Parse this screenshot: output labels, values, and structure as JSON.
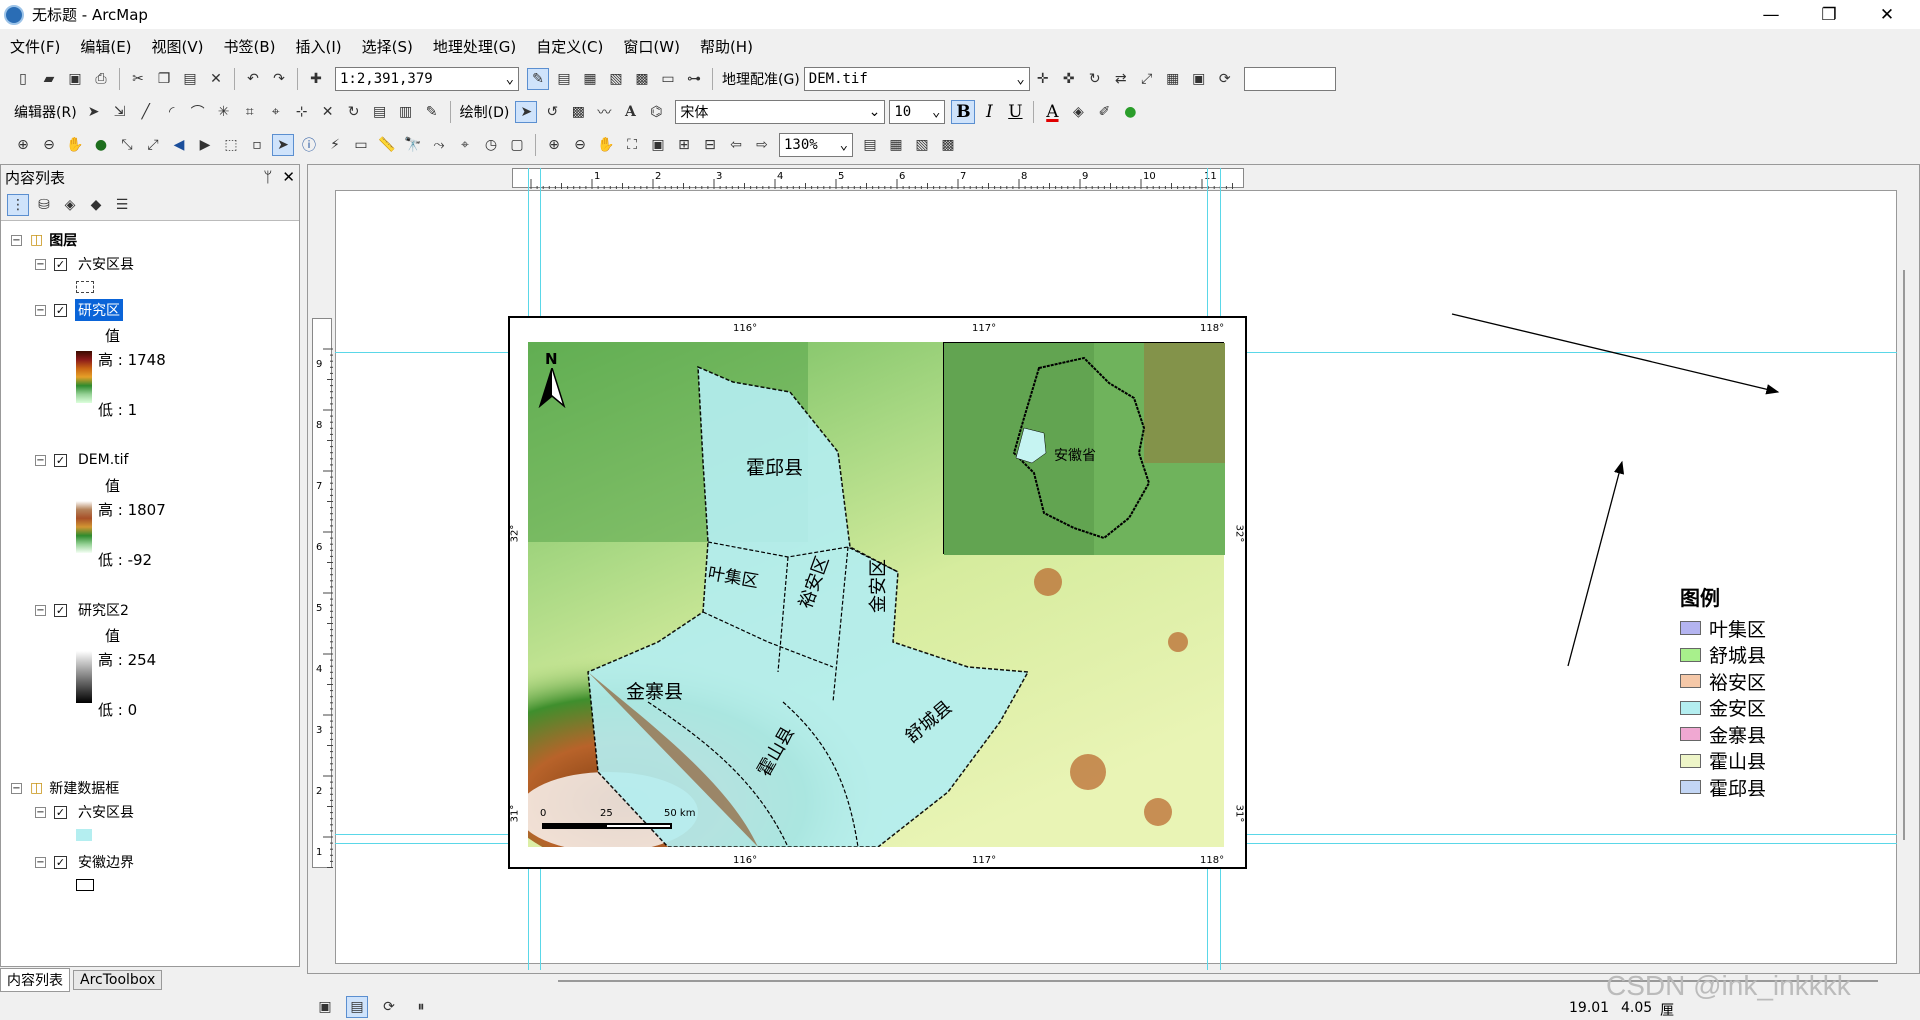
{
  "window": {
    "title": "无标题 - ArcMap",
    "minimize": "—",
    "restore": "❐",
    "close": "✕"
  },
  "menu": [
    "文件(F)",
    "编辑(E)",
    "视图(V)",
    "书签(B)",
    "插入(I)",
    "选择(S)",
    "地理处理(G)",
    "自定义(C)",
    "窗口(W)",
    "帮助(H)"
  ],
  "toolbar": {
    "scale": "1:2,391,379",
    "georef_label": "地理配准(G)",
    "georef_layer": "DEM.tif",
    "editor_label": "编辑器(R)",
    "draw_label": "绘制(D)",
    "font_name": "宋体",
    "font_size": "10",
    "bold": "B",
    "italic": "I",
    "underline": "U",
    "text_tool": "A",
    "zoom": "130%"
  },
  "toc": {
    "title": "内容列表",
    "pin": "ᛘ",
    "close": "✕",
    "layers_group": "图层",
    "layer1": "六安区县",
    "layer2": "研究区",
    "layer2_value_label": "值",
    "layer2_high": "高 : 1748",
    "layer2_low": "低 : 1",
    "layer3": "DEM.tif",
    "layer3_value_label": "值",
    "layer3_high": "高 : 1807",
    "layer3_low": "低 : -92",
    "layer4": "研究区2",
    "layer4_value_label": "值",
    "layer4_high": "高 : 254",
    "layer4_low": "低 : 0",
    "frame2": "新建数据框",
    "frame2_layer1": "六安区县",
    "frame2_layer2": "安徽边界",
    "tab1": "内容列表",
    "tab2": "ArcToolbox"
  },
  "map": {
    "north": "N",
    "districts": [
      "霍邱县",
      "叶集区",
      "裕安区",
      "金安区",
      "金寨县",
      "霍山县",
      "舒城县"
    ],
    "inset_label": "安徽省",
    "top_ticks": [
      "116°",
      "117°",
      "118°"
    ],
    "bottom_ticks": [
      "116°",
      "117°",
      "118°"
    ],
    "left_ticks": [
      "32°",
      "31°"
    ],
    "right_ticks": [
      "32°",
      "31°"
    ],
    "scalebar": [
      "0",
      "25",
      "50 km"
    ]
  },
  "legend": {
    "title": "图例",
    "items": [
      {
        "label": "叶集区",
        "color": "#b4b4f0"
      },
      {
        "label": "舒城县",
        "color": "#a8f08c"
      },
      {
        "label": "裕安区",
        "color": "#f5c8a8"
      },
      {
        "label": "金安区",
        "color": "#b4eef0"
      },
      {
        "label": "金寨县",
        "color": "#f0a8d2"
      },
      {
        "label": "霍山县",
        "color": "#eef5c8"
      },
      {
        "label": "霍邱县",
        "color": "#c3d6f5"
      }
    ]
  },
  "hruler": [
    "1",
    "2",
    "3",
    "4",
    "5",
    "6",
    "7",
    "8",
    "9",
    "10",
    "11"
  ],
  "vruler": [
    "9",
    "8",
    "7",
    "6",
    "5",
    "4",
    "3",
    "2",
    "1"
  ],
  "status": {
    "x": "19.01",
    "y": "4.05",
    "unit": "厘",
    "watermark": "CSDN @ink_inkkkk"
  }
}
